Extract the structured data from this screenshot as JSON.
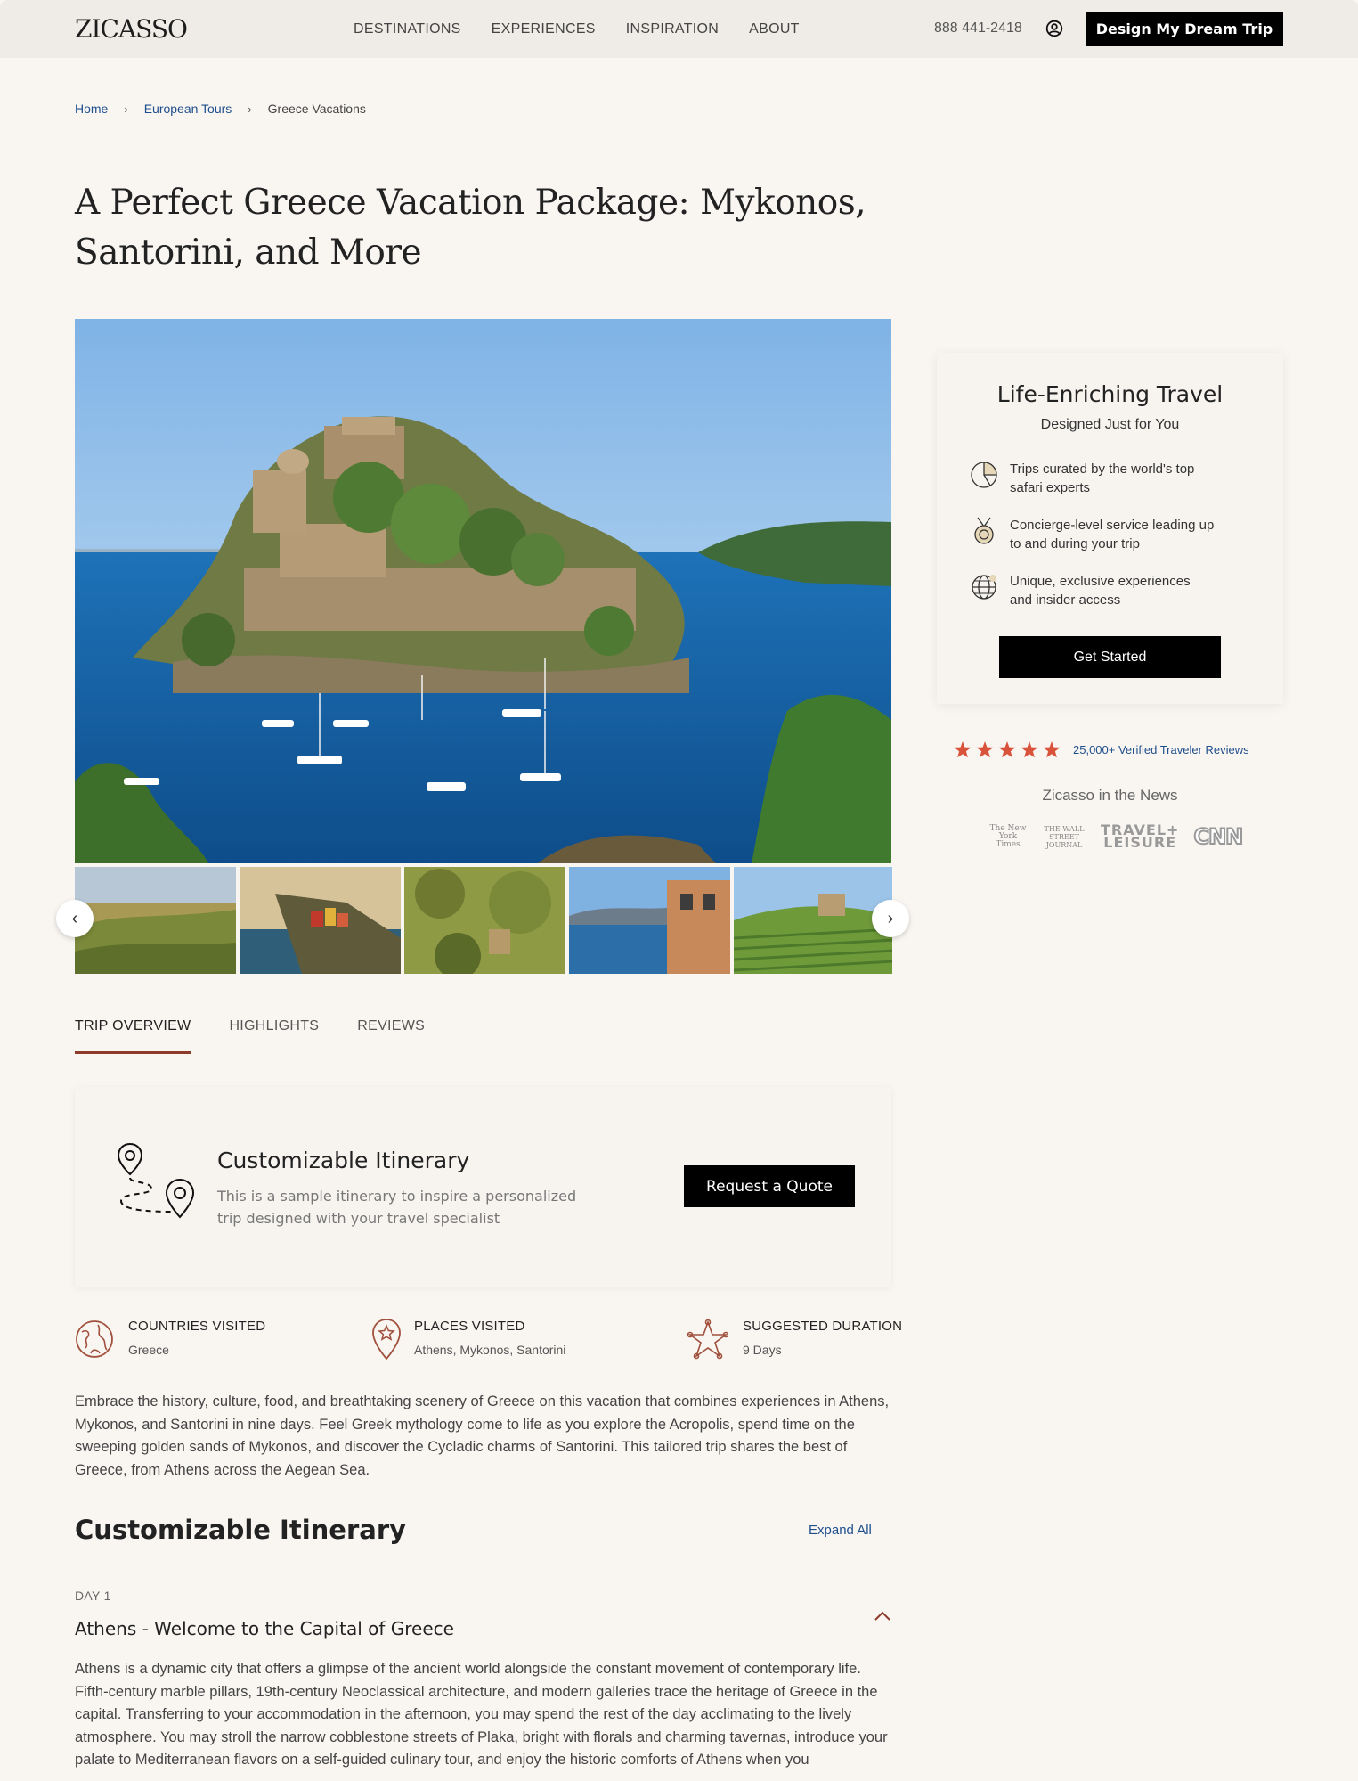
{
  "header": {
    "logo": "ZICASSO",
    "nav": [
      "DESTINATIONS",
      "EXPERIENCES",
      "INSPIRATION",
      "ABOUT"
    ],
    "phone": "888 441-2418",
    "cta": "Design My Dream Trip"
  },
  "breadcrumb": {
    "home": "Home",
    "section": "European Tours",
    "current": "Greece Vacations",
    "separator": "›"
  },
  "title": "A Perfect Greece Vacation Package: Mykonos, Santorini, and More",
  "gallery": {
    "prev_icon": "‹",
    "next_icon": "›"
  },
  "tabs": [
    "TRIP OVERVIEW",
    "HIGHLIGHTS",
    "REVIEWS"
  ],
  "customizable": {
    "title": "Customizable Itinerary",
    "subtitle": "This is a sample itinerary to inspire a personalized trip designed with your travel specialist",
    "button": "Request a Quote"
  },
  "stats": {
    "countries_label": "COUNTRIES VISITED",
    "countries_value": "Greece",
    "places_label": "PLACES VISITED",
    "places_value": "Athens, Mykonos, Santorini",
    "duration_label": "SUGGESTED DURATION",
    "duration_value": "9 Days"
  },
  "description": "Embrace the history, culture, food, and breathtaking scenery of Greece on this vacation that combines experiences in Athens, Mykonos, and Santorini in nine days. Feel Greek mythology come to life as you explore the Acropolis, spend time on the sweeping golden sands of Mykonos, and discover the Cycladic charms of Santorini. This tailored trip shares the best of Greece, from Athens across the Aegean Sea.",
  "itinerary": {
    "title": "Customizable Itinerary",
    "expand": "Expand All",
    "day_label": "DAY 1",
    "day_title": "Athens - Welcome to the Capital of Greece",
    "day_desc": "Athens is a dynamic city that offers a glimpse of the ancient world alongside the constant movement of contemporary life. Fifth-century marble pillars, 19th-century Neoclassical architecture, and modern galleries trace the heritage of Greece in the capital. Transferring to your accommodation in the afternoon, you may spend the rest of the day acclimating to the lively atmosphere. You may stroll the narrow cobblestone streets of Plaka, bright with florals and charming tavernas, introduce your palate to Mediterranean flavors on a self-guided culinary tour, and enjoy the historic comforts of Athens when you"
  },
  "sidebar": {
    "title": "Life-Enriching Travel",
    "subtitle": "Designed Just for You",
    "benefits": [
      "Trips curated by the world's top safari experts",
      "Concierge-level service leading up to and during your trip",
      "Unique, exclusive experiences and insider access"
    ],
    "button": "Get Started",
    "reviews": "25,000+ Verified Traveler Reviews",
    "news_title": "Zicasso in the News",
    "news_logos": {
      "nyt": "The New York Times",
      "wsj": "THE WALL STREET JOURNAL",
      "tl_1": "TRAVEL+",
      "tl_2": "LEISURE",
      "cnn": "CNN"
    }
  },
  "colors": {
    "page_bg": "#f9f6f2",
    "accent_underline": "#8f3b2b",
    "link_blue": "#1f4e8c",
    "star": "#d9533b",
    "icon_rust": "#a0503c"
  }
}
